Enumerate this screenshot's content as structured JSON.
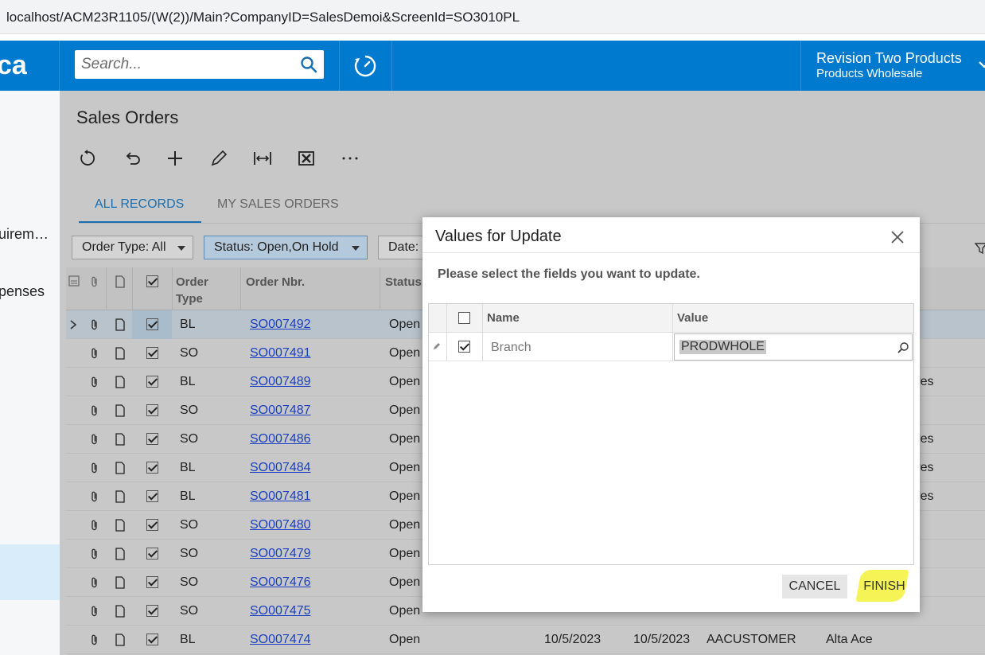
{
  "browser": {
    "url": "localhost/ACM23R1105/(W(2))/Main?CompanyID=SalesDemoi&ScreenId=SO3010PL"
  },
  "topbar": {
    "logo_text": "ca",
    "search_placeholder": "Search...",
    "company_name": "Revision Two Products",
    "company_branch": "Products Wholesale",
    "accent": "#007ace"
  },
  "sidebar": {
    "items": [
      {
        "label": "uirem…"
      },
      {
        "label": "penses"
      }
    ]
  },
  "page": {
    "title": "Sales Orders",
    "tabs": [
      {
        "label": "ALL RECORDS"
      },
      {
        "label": "MY SALES ORDERS"
      }
    ],
    "filters": [
      {
        "label": "Order Type: All"
      },
      {
        "label": "Status: Open,On Hold"
      },
      {
        "label": "Date:"
      }
    ]
  },
  "grid": {
    "headers": {
      "order_type": "Order\nType",
      "order_type_l1": "Order",
      "order_type_l2": "Type",
      "order_nbr": "Order Nbr.",
      "status": "Status"
    },
    "rows": [
      {
        "type": "BL",
        "nbr": "SO007492",
        "status": "Open",
        "extra": ""
      },
      {
        "type": "SO",
        "nbr": "SO007491",
        "status": "Open",
        "extra": ""
      },
      {
        "type": "BL",
        "nbr": "SO007489",
        "status": "Open",
        "extra": "ntures"
      },
      {
        "type": "SO",
        "nbr": "SO007487",
        "status": "Open",
        "extra": ""
      },
      {
        "type": "SO",
        "nbr": "SO007486",
        "status": "Open",
        "extra": "ntures"
      },
      {
        "type": "BL",
        "nbr": "SO007484",
        "status": "Open",
        "extra": "ntures"
      },
      {
        "type": "BL",
        "nbr": "SO007481",
        "status": "Open",
        "extra": "ntures"
      },
      {
        "type": "SO",
        "nbr": "SO007480",
        "status": "Open",
        "extra": ""
      },
      {
        "type": "SO",
        "nbr": "SO007479",
        "status": "Open",
        "extra": ""
      },
      {
        "type": "SO",
        "nbr": "SO007476",
        "status": "Open",
        "extra": ""
      },
      {
        "type": "SO",
        "nbr": "SO007475",
        "status": "Open",
        "extra": ""
      },
      {
        "type": "BL",
        "nbr": "SO007474",
        "status": "Open",
        "extra": ""
      }
    ],
    "last_row": {
      "date1": "10/5/2023",
      "date2": "10/5/2023",
      "customer": "AACUSTOMER",
      "customer_name": "Alta Ace"
    },
    "partial_row": {
      "date1": "10/5/2023",
      "date2": "10/5/2023",
      "customer": "AACUSTOMER",
      "customer_name": "Alta Ace"
    }
  },
  "dialog": {
    "title": "Values for Update",
    "message": "Please select the fields you want to update.",
    "col_name": "Name",
    "col_value": "Value",
    "row": {
      "name": "Branch",
      "value": "PRODWHOLE"
    },
    "cancel": "CANCEL",
    "finish": "FINISH"
  }
}
